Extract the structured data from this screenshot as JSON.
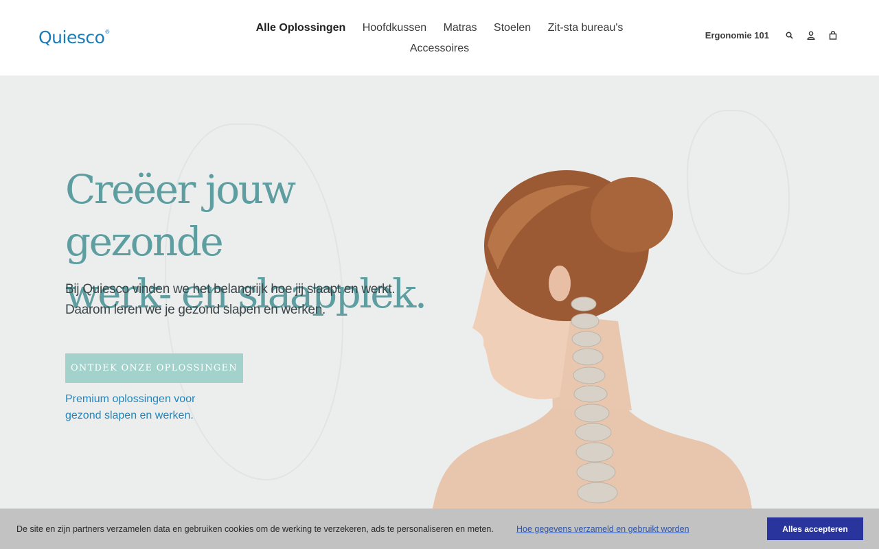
{
  "brand": {
    "logo_text": "Quiesco",
    "logo_mark": "®",
    "color": "#1a7bb9"
  },
  "nav": {
    "items": [
      {
        "label": "Alle Oplossingen",
        "active": true
      },
      {
        "label": "Hoofdkussen"
      },
      {
        "label": "Matras"
      },
      {
        "label": "Stoelen"
      },
      {
        "label": "Zit-sta bureau's"
      },
      {
        "label": "Accessoires"
      }
    ]
  },
  "utility": {
    "ergonomics_label": "Ergonomie 101",
    "icons": [
      "search-icon",
      "account-icon",
      "cart-icon"
    ]
  },
  "hero": {
    "title_line1": "Creëer jouw gezonde",
    "title_line2": "werk- en slaapplek.",
    "lead_line1": "Bij Quiesco vinden we het belangrijk hoe jij slaapt en werkt.",
    "lead_line2": "Daarom leren we je gezond slapen en werken.",
    "cta_label": "ONTDEK ONZE OPLOSSINGEN",
    "tagline_line1": "Premium oplossingen voor",
    "tagline_line2": "gezond slapen en werken.",
    "title_color": "#5e9ea0",
    "cta_color": "#a3d1cc"
  },
  "cookie": {
    "message": "De site en zijn partners verzamelen data en gebruiken cookies om de werking te verzekeren, ads te personaliseren en meten.",
    "link_label": "Hoe gegevens verzameld en gebruikt worden",
    "accept_label": "Alles accepteren",
    "accept_color": "#29359d"
  }
}
